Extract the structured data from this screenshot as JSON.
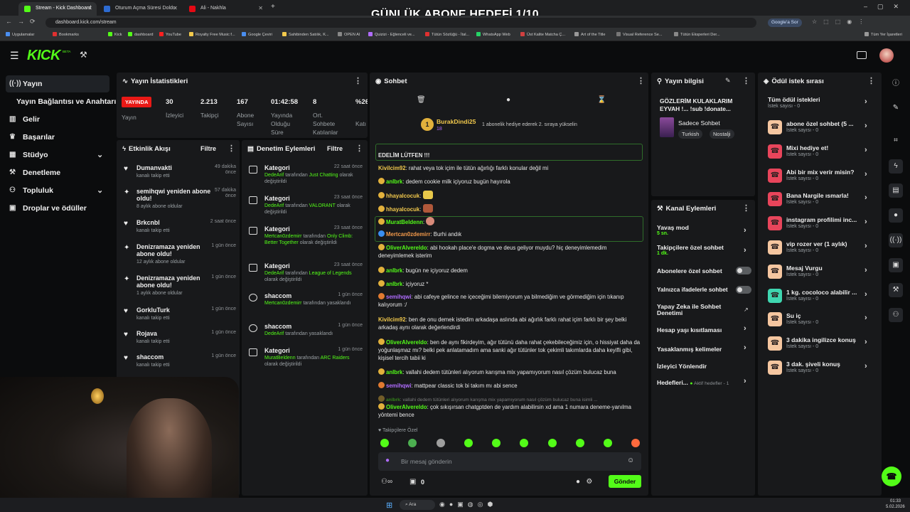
{
  "overlay_title": "GÜNLÜK ABONE HEDEFİ 1/10",
  "browser": {
    "tabs": [
      "Stream - Kick Dashboard",
      "Oturum Açma Süresi Doldu",
      "Ali - Nakhla"
    ],
    "url": "dashboard.kick.com/stream",
    "google_label": "Google'a Sor",
    "bookmarks": [
      "Uygulamalar",
      "Bookmarks",
      "Kick",
      "dashboard",
      "YouTube",
      "Royalty Free Music f...",
      "Google Çeviri",
      "Sahibinden Satılık, K...",
      "OPEN AI",
      "Quizizi - Eğlenceli ve...",
      "Tütün Sözlüğü - İtal...",
      "WhatsApp Web",
      "Üst Kalite Matcha Ç...",
      "Art of the Title",
      "Visual Reference Se...",
      "Tütün Eksperleri Der...",
      "Tüm Yer İşaretleri"
    ]
  },
  "topnav": {
    "logo": "KICK",
    "logo_badge": "BETA"
  },
  "sidebar": {
    "items": [
      {
        "label": "Yayın",
        "icon": "broadcast-icon"
      },
      {
        "label": "Yayın Bağlantısı ve Anahtarı",
        "icon": ""
      },
      {
        "label": "Gelir",
        "icon": "bank-icon"
      },
      {
        "label": "Başarılar",
        "icon": "trophy-icon"
      },
      {
        "label": "Stüdyo",
        "icon": "grid-icon"
      },
      {
        "label": "Denetleme",
        "icon": "hammer-icon"
      },
      {
        "label": "Topluluk",
        "icon": "people-icon"
      },
      {
        "label": "Droplar ve ödüller",
        "icon": "gift-icon"
      }
    ]
  },
  "stats": {
    "title": "Yayın İstatistikleri",
    "live_badge": "YAYINDA",
    "live_label": "Yayın",
    "items": [
      {
        "value": "30",
        "label": "İzleyici"
      },
      {
        "value": "2.213",
        "label": "Takipçi"
      },
      {
        "value": "167",
        "label": "Abone Sayısı"
      },
      {
        "value": "01:42:58",
        "label": "Yayında Olduğu Süre"
      },
      {
        "value": "8",
        "label": "Ort. Sohbete Katılanlar"
      },
      {
        "value": "%26",
        "label": "Katı"
      }
    ]
  },
  "activity": {
    "title": "Etkinlik Akışı",
    "filter": "Filtre",
    "items": [
      {
        "title": "Dumanvakti",
        "sub": "kanalı takip etti",
        "time": "49 dakika önce",
        "icon": "heart-icon"
      },
      {
        "title": "semihqwi yeniden abone oldu!",
        "sub": "8 aylık abone oldular",
        "time": "57 dakika önce",
        "icon": "star-icon"
      },
      {
        "title": "Brkcnbl",
        "sub": "kanalı takip etti",
        "time": "2 saat önce",
        "icon": "heart-icon"
      },
      {
        "title": "Denizramaza yeniden abone oldu!",
        "sub": "12 aylık abone oldular",
        "time": "1 gün önce",
        "icon": "star-icon"
      },
      {
        "title": "Denizramaza yeniden abone oldu!",
        "sub": "1 aylık abone oldular",
        "time": "1 gün önce",
        "icon": "star-icon"
      },
      {
        "title": "GorkluTurk",
        "sub": "kanalı takip etti",
        "time": "1 gün önce",
        "icon": "heart-icon"
      },
      {
        "title": "Rojava",
        "sub": "kanalı takip etti",
        "time": "1 gün önce",
        "icon": "heart-icon"
      },
      {
        "title": "shaccom",
        "sub": "kanalı takip etti",
        "time": "1 gün önce",
        "icon": "heart-icon"
      }
    ]
  },
  "moderation": {
    "title": "Denetim Eylemleri",
    "filter": "Filtre",
    "items": [
      {
        "title": "Kategori",
        "time": "22 saat önce",
        "actor": "DedeArif",
        "pre": "tarafından",
        "target": "Just Chatting",
        "post": "olarak değiştirildi"
      },
      {
        "title": "Kategori",
        "time": "23 saat önce",
        "actor": "DedeArif",
        "pre": "tarafından",
        "target": "VALORANT",
        "post": "olarak değiştirildi"
      },
      {
        "title": "Kategori",
        "time": "23 saat önce",
        "actor": "Mertcan0zdemirr",
        "pre": "tarafından",
        "target": "Only Climb: Better Together",
        "post": "olarak değiştirildi"
      },
      {
        "title": "Kategori",
        "time": "23 saat önce",
        "actor": "DedeArif",
        "pre": "tarafından",
        "target": "League of Legends",
        "post": "olarak değiştirildi"
      },
      {
        "title": "shaccom",
        "time": "1 gün önce",
        "actor": "Mertcan0zdemirr",
        "pre": "tarafından",
        "target": "",
        "post": "yasaklandı"
      },
      {
        "title": "shaccom",
        "time": "1 gün önce",
        "actor": "DedeArif",
        "pre": "tarafından yasaklandı",
        "target": "",
        "post": ""
      },
      {
        "title": "Kategori",
        "time": "1 gün önce",
        "actor": "MuratBeldenn",
        "pre": "tarafından",
        "target": "ARC Raiders",
        "post": "olarak değiştirildi"
      }
    ]
  },
  "chat": {
    "title": "Sohbet",
    "pinned_user": "BurakDindi25",
    "pinned_count": "18",
    "pinned_msg": "1 abonelik hediye ederek 2. sıraya yükselin",
    "top_msg": "EDELİM LÜTFEN !!!",
    "messages": [
      {
        "user": "Kivilcim92",
        "color": "#f2c94c",
        "text": "rahat veya tok içim ile tütün ağırlığı farklı konular değil mi"
      },
      {
        "user": "anlbrk",
        "color": "#53fc18",
        "text": "dedem cookie milk içiyoruz bugün hayırola"
      },
      {
        "user": "hhayalcocuk",
        "color": "#f2c94c",
        "text": ""
      },
      {
        "user": "hhayalcocuk",
        "color": "#f2c94c",
        "text": ""
      },
      {
        "user": "MuratBeldenn",
        "color": "#53fc18",
        "text": ""
      },
      {
        "user": "Mertcan0zdemirr",
        "color": "#f2994a",
        "text": "Burhi andık"
      },
      {
        "user": "OliverAlvereldo",
        "color": "#53fc18",
        "text": "abi hookah place'e dogma ve deus geliyor muydu? hiç deneyimlemedim deneyimlemek isterim"
      },
      {
        "user": "anlbrk",
        "color": "#53fc18",
        "text": "bugün ne içiyoruz dedem"
      },
      {
        "user": "anlbrk",
        "color": "#53fc18",
        "text": "içiyoruz *"
      },
      {
        "user": "semihqwi",
        "color": "#b06cff",
        "text": "abi cafeye gelince ne içeceğimi bilemiyorum ya bilmediğim ve görmediğim için tıkanıp kalıyorum :/"
      },
      {
        "user": "Kivilcim92",
        "color": "#f2c94c",
        "text": "ben de onu demek istedim arkadaşa aslında abi ağırlık farklı rahat içim farklı bir şey belki arkadaş aynı olarak değerlendirdi"
      },
      {
        "user": "OliverAlvereldo",
        "color": "#53fc18",
        "text": "ben de aynı fikirdeyim, ağır tütünü daha rahat çekebileceğimiz için, o hissiyat daha da yoğunlaşmaz mı? belki pek anlatamadım ama sanki ağır tütünler tok çekimli takımlarda daha keyifli gibi, kişisel tercih tabii ki"
      },
      {
        "user": "anlbrk",
        "color": "#53fc18",
        "text": "vallahi dedem tütünleri alıyorum karışma mix yapamıyorum nasıl çözüm bulucaz buna"
      },
      {
        "user": "semihqwi",
        "color": "#b06cff",
        "text": "mattpear classic tok bi takım mı abi sence"
      },
      {
        "user": "anlbrk",
        "color": "#53fc18",
        "text": "vallahi dedem tütünleri alıyorum karışma mix yapamıyorum nasıl çözüm bulucaz buna isimli ..."
      },
      {
        "user": "OliverAlvereldo",
        "color": "#53fc18",
        "text": "çok sıkışırsan chatgptden de yardım alabilirsin xd ama 1 numara deneme-yanılma yöntemi bence"
      }
    ],
    "followers_only": "Takipçilere Özel",
    "input_placeholder": "Bir mesaj gönderin",
    "send": "Gönder",
    "count": "0"
  },
  "stream_info": {
    "title": "Yayın bilgisi",
    "stream_title": "GÖZLERİM KULAKLARIM EYVAH !... !sub !donate...",
    "category": "Sadece Sohbet",
    "tags": [
      "Turkish",
      "Nostalji"
    ]
  },
  "channel_actions": {
    "title": "Kanal Eylemleri",
    "slow_mode": "Yavaş mod",
    "slow_mode_val": "5 sn.",
    "followers_chat": "Takipçilere özel sohbet",
    "followers_chat_val": "1 dk.",
    "subs_chat": "Abonelere özel sohbet",
    "emote_only": "Yalnızca ifadelerle sohbet",
    "ai_chat": "Yapay Zeka ile Sohbet Denetimi",
    "age_limit": "Hesap yaşı kısıtlaması",
    "banned_words": "Yasaklanmış kelimeler",
    "redirect": "İzleyici Yönlendir",
    "goals": "Hedefleri...",
    "goals_val": "Aktif hedefler - 1"
  },
  "rewards": {
    "title": "Ödül istek sırası",
    "all_title": "Tüm ödül istekleri",
    "all_sub": "İstek sayısı - 0",
    "items": [
      {
        "title": "abone özel sohbet (5 ...",
        "sub": "İstek sayısı - 0",
        "color": "#f5c6a0"
      },
      {
        "title": "Mixi hediye et!",
        "sub": "İstek sayısı - 0",
        "color": "#e8455b"
      },
      {
        "title": "Abi bir mix verir misin?",
        "sub": "İstek sayısı - 0",
        "color": "#e8455b"
      },
      {
        "title": "Bana Nargile ısmarla!",
        "sub": "İstek sayısı - 0",
        "color": "#e8455b"
      },
      {
        "title": "instagram profilimi inc...",
        "sub": "İstek sayısı - 0",
        "color": "#e8455b"
      },
      {
        "title": "vip rozer ver (1 aylık)",
        "sub": "İstek sayısı - 0",
        "color": "#f5c6a0"
      },
      {
        "title": "Mesaj Vurgu",
        "sub": "İstek sayısı - 0",
        "color": "#f5c6a0"
      },
      {
        "title": "1 kg. cocoloco alabilir ...",
        "sub": "İstek sayısı - 0",
        "color": "#3fd6b0"
      },
      {
        "title": "Su iç",
        "sub": "İstek sayısı - 0",
        "color": "#f5c6a0"
      },
      {
        "title": "3 dakika ingilizce konuş",
        "sub": "İstek sayısı - 0",
        "color": "#f5c6a0"
      },
      {
        "title": "3 dak. şiveli konuş",
        "sub": "İstek sayısı - 0",
        "color": "#f5c6a0"
      }
    ]
  },
  "taskbar": {
    "search": "Ara",
    "time": "01:33",
    "date": "5.02.2026"
  },
  "colors": {
    "accent": "#53fc18",
    "live": "#e91916"
  }
}
